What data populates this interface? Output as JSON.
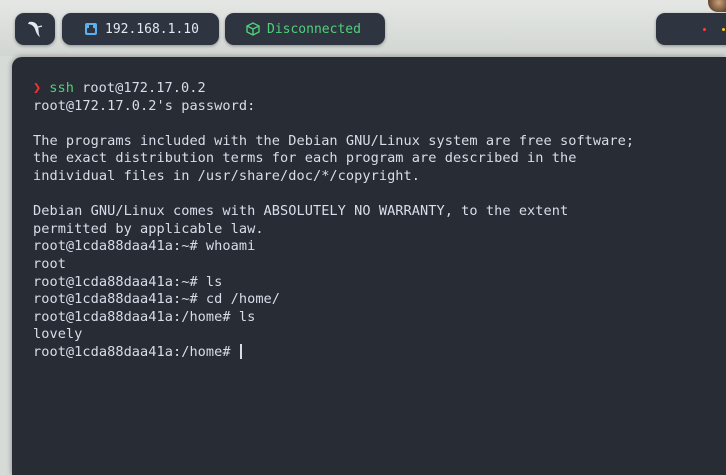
{
  "topbar": {
    "ip_label": "192.168.1.10",
    "status_label": "Disconnected",
    "colors": {
      "pill_bg": "#2e3440",
      "status_green": "#4fd17a",
      "ip_icon_blue": "#5ab0f0"
    }
  },
  "terminal": {
    "colors": {
      "background": "#272c35",
      "text": "#d8dee9",
      "prompt_arrow": "#ff3030",
      "command_green": "#4fd17a"
    },
    "first_command": {
      "arrow": "❯",
      "program": "ssh",
      "args": " root@172.17.0.2"
    },
    "lines": [
      "root@172.17.0.2's password:",
      "",
      "The programs included with the Debian GNU/Linux system are free software;",
      "the exact distribution terms for each program are described in the",
      "individual files in /usr/share/doc/*/copyright.",
      "",
      "Debian GNU/Linux comes with ABSOLUTELY NO WARRANTY, to the extent",
      "permitted by applicable law.",
      "root@1cda88daa41a:~# whoami",
      "root",
      "root@1cda88daa41a:~# ls",
      "root@1cda88daa41a:~# cd /home/",
      "root@1cda88daa41a:/home# ls",
      "lovely"
    ],
    "current_prompt": "root@1cda88daa41a:/home# "
  }
}
